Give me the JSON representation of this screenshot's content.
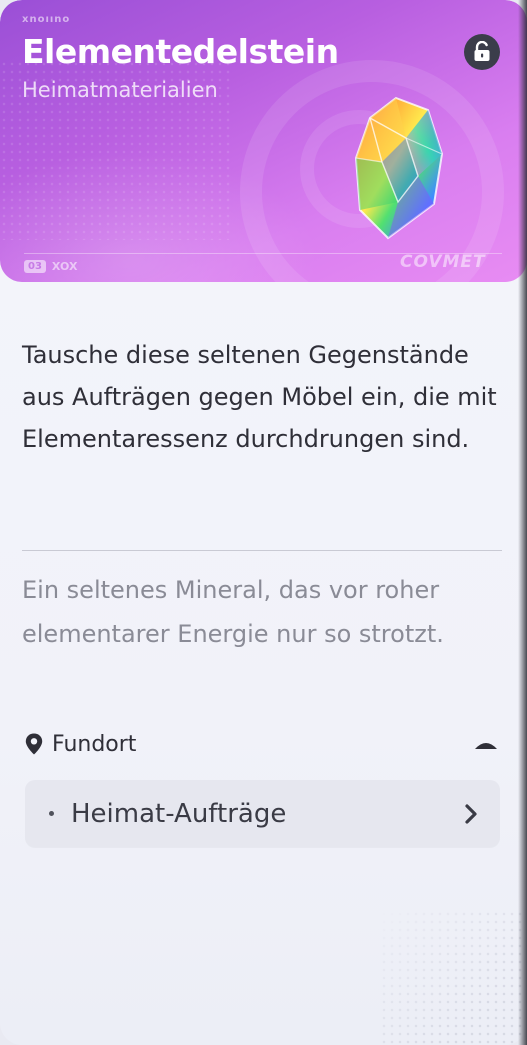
{
  "item": {
    "brand_top": "xnoııno",
    "name": "Elementedelstein",
    "category": "Heimatmaterialien",
    "brand_bottom": "COVMET",
    "footer_badge": "03",
    "footer_tag": "XOX",
    "lock_state": "unlocked",
    "lock_icon": "open-lock-icon",
    "image_icon": "rainbow-gem-icon"
  },
  "description": "Tausche diese seltenen Gegenstände aus Aufträgen gegen Möbel ein, die mit Elementaressenz durchdrungen sind.",
  "flavor_text": "Ein seltenes Mineral, das vor roher elementarer Energie nur so strotzt.",
  "source_section": {
    "label": "Fundort",
    "icon": "location-pin-icon",
    "expanded": true,
    "items": [
      {
        "label": "Heimat-Aufträge",
        "icon": "chevron-right-icon"
      }
    ]
  },
  "colors": {
    "header_gradient_start": "#9a4fd6",
    "header_gradient_end": "#e88cf3",
    "panel_bg": "#f3f4fa",
    "text_primary": "#2f2f38",
    "text_secondary": "#8a8b96"
  }
}
